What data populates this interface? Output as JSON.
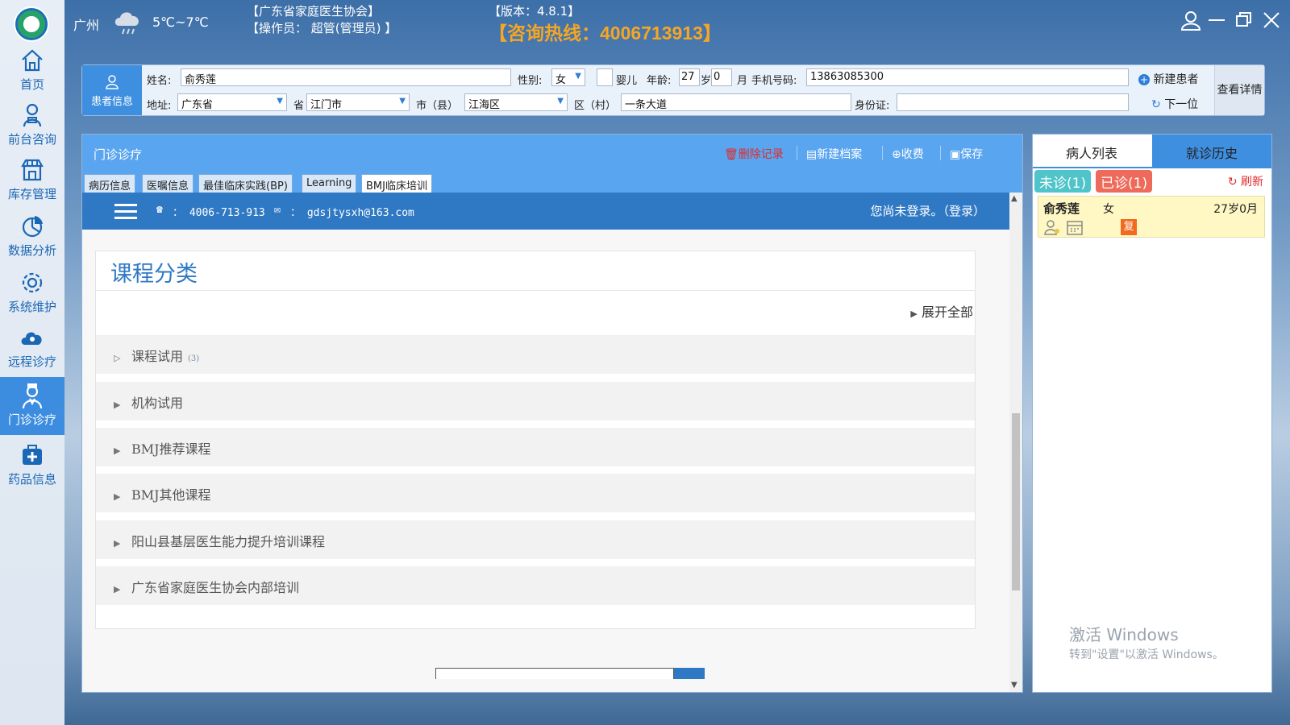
{
  "topbar": {
    "city": "广州",
    "temperature": "5℃~7℃",
    "association": "【广东省家庭医生协会】",
    "operator": "【操作员： 超管(管理员) 】",
    "version": "【版本：4.8.1】",
    "hotline": "【咨询热线：4006713913】"
  },
  "sidebar": {
    "items": [
      {
        "label": "首页",
        "icon": "home-icon"
      },
      {
        "label": "前台咨询",
        "icon": "receptionist-icon"
      },
      {
        "label": "库存管理",
        "icon": "store-icon"
      },
      {
        "label": "数据分析",
        "icon": "pie-chart-icon"
      },
      {
        "label": "系统维护",
        "icon": "gear-icon"
      },
      {
        "label": "远程诊疗",
        "icon": "cloud-icon"
      },
      {
        "label": "门诊诊疗",
        "icon": "doctor-icon"
      },
      {
        "label": "药品信息",
        "icon": "medicine-box-icon"
      }
    ],
    "active": "门诊诊疗"
  },
  "patient": {
    "tab_label": "患者信息",
    "name_label": "姓名:",
    "name": "俞秀莲",
    "gender_label": "性别:",
    "gender": "女",
    "infant_label": "婴儿",
    "age_label": "年龄:",
    "age_years": "27",
    "years_unit": "岁",
    "age_months": "0",
    "months_unit": "月",
    "phone_label": "手机号码:",
    "phone": "13863085300",
    "address_label": "地址:",
    "province": "广东省",
    "province_label": "省",
    "city": "江门市",
    "city_label": "市（县）",
    "county": "江海区",
    "district_label": "区（村）",
    "street": "一条大道",
    "id_label": "身份证:",
    "id_value": "",
    "new_patient": "新建患者",
    "next": "下一位",
    "view_detail": "查看详情"
  },
  "main": {
    "title": "门诊诊疗",
    "actions": {
      "delete": "删除记录",
      "new_record": "新建档案",
      "charge": "收费",
      "save": "保存"
    },
    "tabs": [
      "病历信息",
      "医嘱信息",
      "最佳临床实践(BP)",
      "Learning",
      "BMJ临床培训"
    ],
    "active_tab": "BMJ临床培训"
  },
  "web": {
    "phone": "： 4006-713-913",
    "email": "： gdsjtysxh@163.com",
    "login": "您尚未登录。（登录）",
    "course_title": "课程分类",
    "expand_all": "展开全部",
    "categories": [
      {
        "label": "课程试用",
        "count": "(3)"
      },
      {
        "label": "机构试用",
        "count": ""
      },
      {
        "label": "BMJ推荐课程",
        "count": ""
      },
      {
        "label": "BMJ其他课程",
        "count": ""
      },
      {
        "label": "阳山县基层医生能力提升培训课程",
        "count": ""
      },
      {
        "label": "广东省家庭医生协会内部培训",
        "count": ""
      }
    ]
  },
  "right": {
    "tab_patients": "病人列表",
    "tab_history": "就诊历史",
    "waiting": "未诊(1)",
    "done": "已诊(1)",
    "refresh": "刷新",
    "card": {
      "name": "俞秀莲",
      "gender": "女",
      "age": "27岁0月",
      "badge": "复"
    }
  },
  "watermark": {
    "line1": "激活 Windows",
    "line2": "转到\"设置\"以激活 Windows。"
  },
  "colors": {
    "accent": "#3f8fe0",
    "header": "#5aa5f0",
    "hotline": "#f5a623",
    "danger": "#e02a2a"
  }
}
